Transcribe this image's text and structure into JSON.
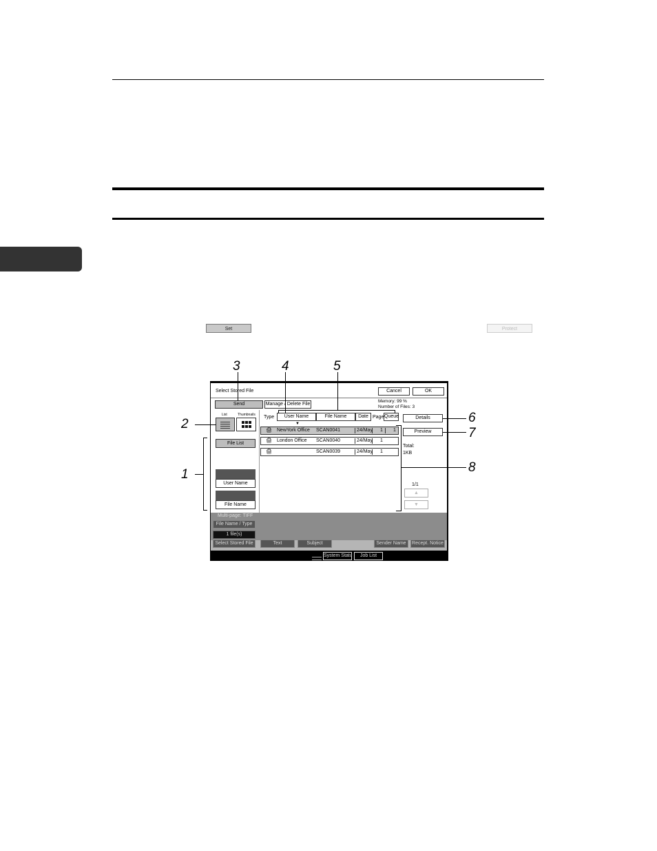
{
  "page_buttons": {
    "set_label": "Set",
    "print_label": "Protect"
  },
  "callouts": {
    "c1": "1",
    "c2": "2",
    "c3": "3",
    "c4": "4",
    "c5": "5",
    "c6": "6",
    "c7": "7",
    "c8": "8"
  },
  "screen": {
    "title": "Select Stored File",
    "cancel_label": "Cancel",
    "ok_label": "OK",
    "send_tab": "Send",
    "manage_tab": "Manage / Delete File",
    "memory": "Memory: 99 %",
    "num_files": "Number of Files: 3",
    "view_list_label": "List",
    "view_thumb_label": "Thumbnails",
    "type_label": "Type",
    "columns": {
      "user": "User Name",
      "file": "File Name",
      "date": "Date",
      "page": "Page",
      "queue": "Queue"
    },
    "sort_indicator": "▼",
    "details_label": "Details",
    "preview_label": "Preview",
    "total_label": "Total:",
    "total_size": "1KB",
    "page_indicator": "1/1",
    "page_up": "▲",
    "page_down": "▼",
    "file_list_label": "File List",
    "user_name_btn": "User Name",
    "file_name_btn": "File Name",
    "rows": [
      {
        "icon": "🖨",
        "user": "NewYork Office",
        "file": "SCAN0041",
        "date": "24/May",
        "page": "1",
        "queue": "1"
      },
      {
        "icon": "🖨",
        "user": "London Office",
        "file": "SCAN0040",
        "date": "24/May",
        "page": "1",
        "queue": ""
      },
      {
        "icon": "🖨",
        "user": "",
        "file": "SCAN0039",
        "date": "24/May",
        "page": "1",
        "queue": ""
      }
    ],
    "multipage": "Multi-page: TIFF",
    "filename_type": "File Name / Type",
    "files_count": "1 file(s)",
    "select_stored": "Select Stored File",
    "text_btn": "Text",
    "subject_btn": "Subject",
    "sender_name": "Sender Name",
    "recept_notice": "Recept. Notice",
    "system_status": "System Status",
    "job_list": "Job List"
  }
}
